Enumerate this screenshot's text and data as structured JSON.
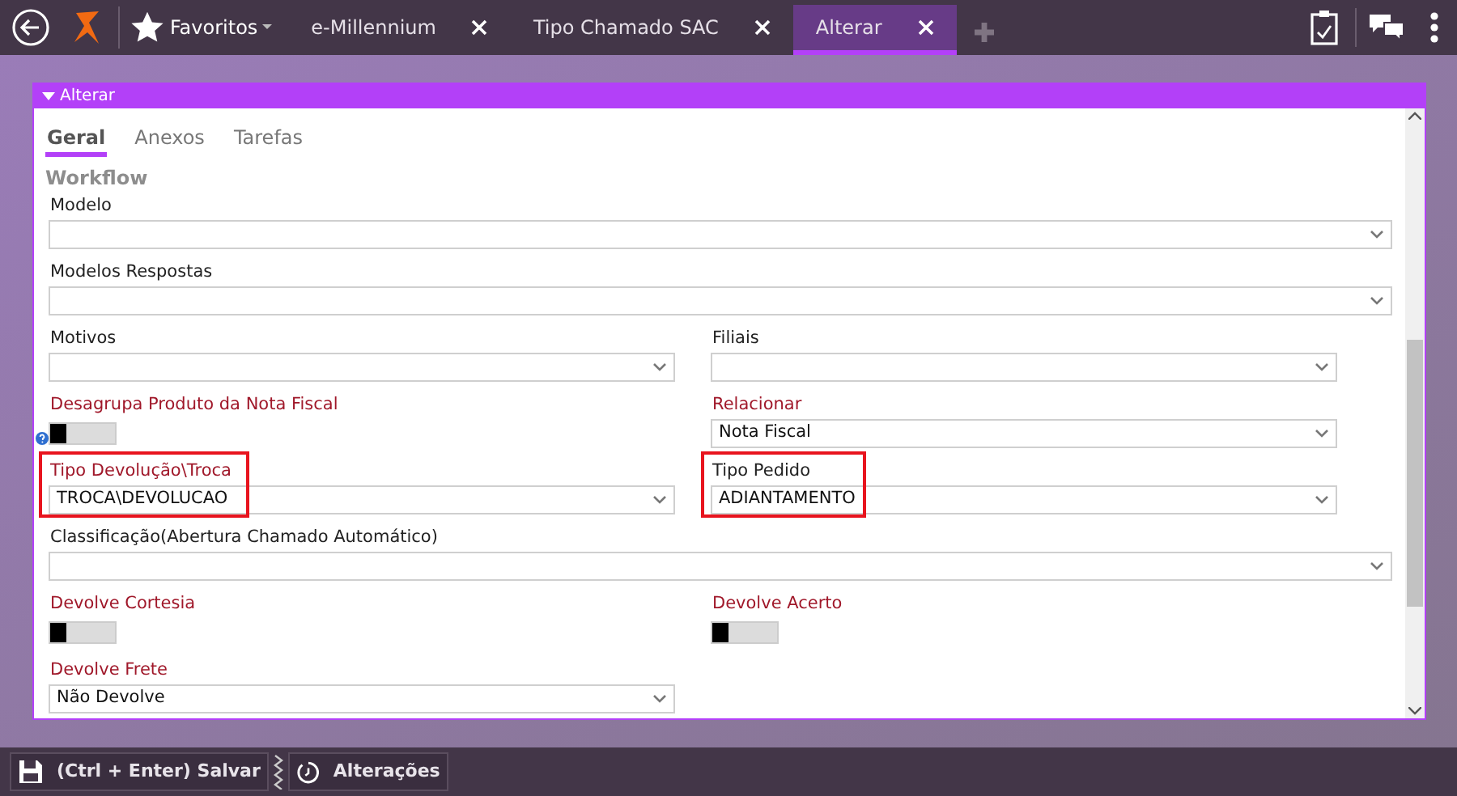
{
  "top_bar": {
    "favorites": "Favoritos",
    "tabs": [
      {
        "label": "e-Millennium",
        "selected": false
      },
      {
        "label": "Tipo Chamado SAC",
        "selected": false
      },
      {
        "label": "Alterar",
        "selected": true
      }
    ]
  },
  "panel": {
    "title": "Alterar",
    "tabs": [
      {
        "label": "Geral",
        "selected": true
      },
      {
        "label": "Anexos",
        "selected": false
      },
      {
        "label": "Tarefas",
        "selected": false
      }
    ],
    "section": "Workflow",
    "rows": [
      [
        {
          "kind": "select",
          "label": "Modelo",
          "required": false,
          "highlighted": false
        }
      ],
      [
        {
          "kind": "select",
          "label": "Modelos Respostas",
          "required": false,
          "highlighted": false
        }
      ],
      [
        {
          "kind": "select",
          "label": "Motivos",
          "required": false,
          "highlighted": false
        },
        {
          "kind": "select",
          "label": "Filiais",
          "required": false,
          "highlighted": false
        }
      ],
      [
        {
          "kind": "toggle",
          "label": "Desagrupa Produto da Nota Fiscal",
          "required": true,
          "highlighted": false,
          "on": false,
          "help": true
        },
        {
          "kind": "select",
          "label": "Relacionar",
          "value": "Nota Fiscal",
          "required": true,
          "highlighted": false
        }
      ],
      [
        {
          "kind": "select",
          "label": "Tipo Devolução\\Troca",
          "value": "TROCA\\DEVOLUCAO",
          "required": true,
          "highlighted": true
        },
        {
          "kind": "select",
          "label": "Tipo Pedido",
          "value": "ADIANTAMENTO",
          "required": false,
          "highlighted": true
        }
      ],
      [
        {
          "kind": "select",
          "label": "Classificação(Abertura Chamado Automático)",
          "required": false,
          "highlighted": false
        }
      ],
      [
        {
          "kind": "toggle",
          "label": "Devolve Cortesia",
          "required": true,
          "highlighted": false,
          "on": false
        },
        {
          "kind": "toggle",
          "label": "Devolve Acerto",
          "required": true,
          "highlighted": false,
          "on": false
        }
      ],
      [
        {
          "kind": "select",
          "label": "Devolve Frete",
          "value": "Não Devolve",
          "required": true,
          "highlighted": false,
          "half": true
        }
      ]
    ]
  },
  "bottom_bar": {
    "buttons": [
      "(Ctrl + Enter) Salvar",
      "Alterações"
    ]
  }
}
